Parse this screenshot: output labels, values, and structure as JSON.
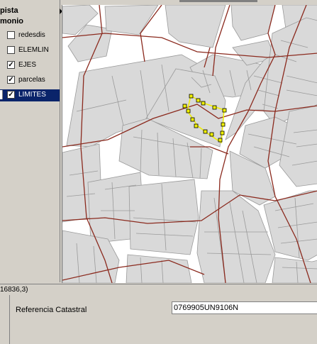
{
  "layers_panel": {
    "title": "pista",
    "subtitle": "monio",
    "layers": [
      {
        "label": "redesdis",
        "check": "",
        "checked": false,
        "selected": false
      },
      {
        "label": "ELEMLIN",
        "check": "",
        "checked": false,
        "selected": false
      },
      {
        "label": "EJES",
        "check": "✓",
        "checked": true,
        "selected": false
      },
      {
        "label": "parcelas",
        "check": "✓",
        "checked": true,
        "selected": false
      },
      {
        "label": "LIMITES",
        "check": "✓",
        "checked": true,
        "selected": true
      }
    ]
  },
  "map": {
    "block_color": "#d9d9d9",
    "parcel_line_color": "#9a9a9a",
    "street_line_color": "#8b2a1e",
    "selection_color": "#f0f000"
  },
  "status_bar": {
    "text": "16836,3)"
  },
  "info_panel": {
    "ref_label": "Referencia Catastral",
    "ref_value": "0769905UN9106N"
  }
}
